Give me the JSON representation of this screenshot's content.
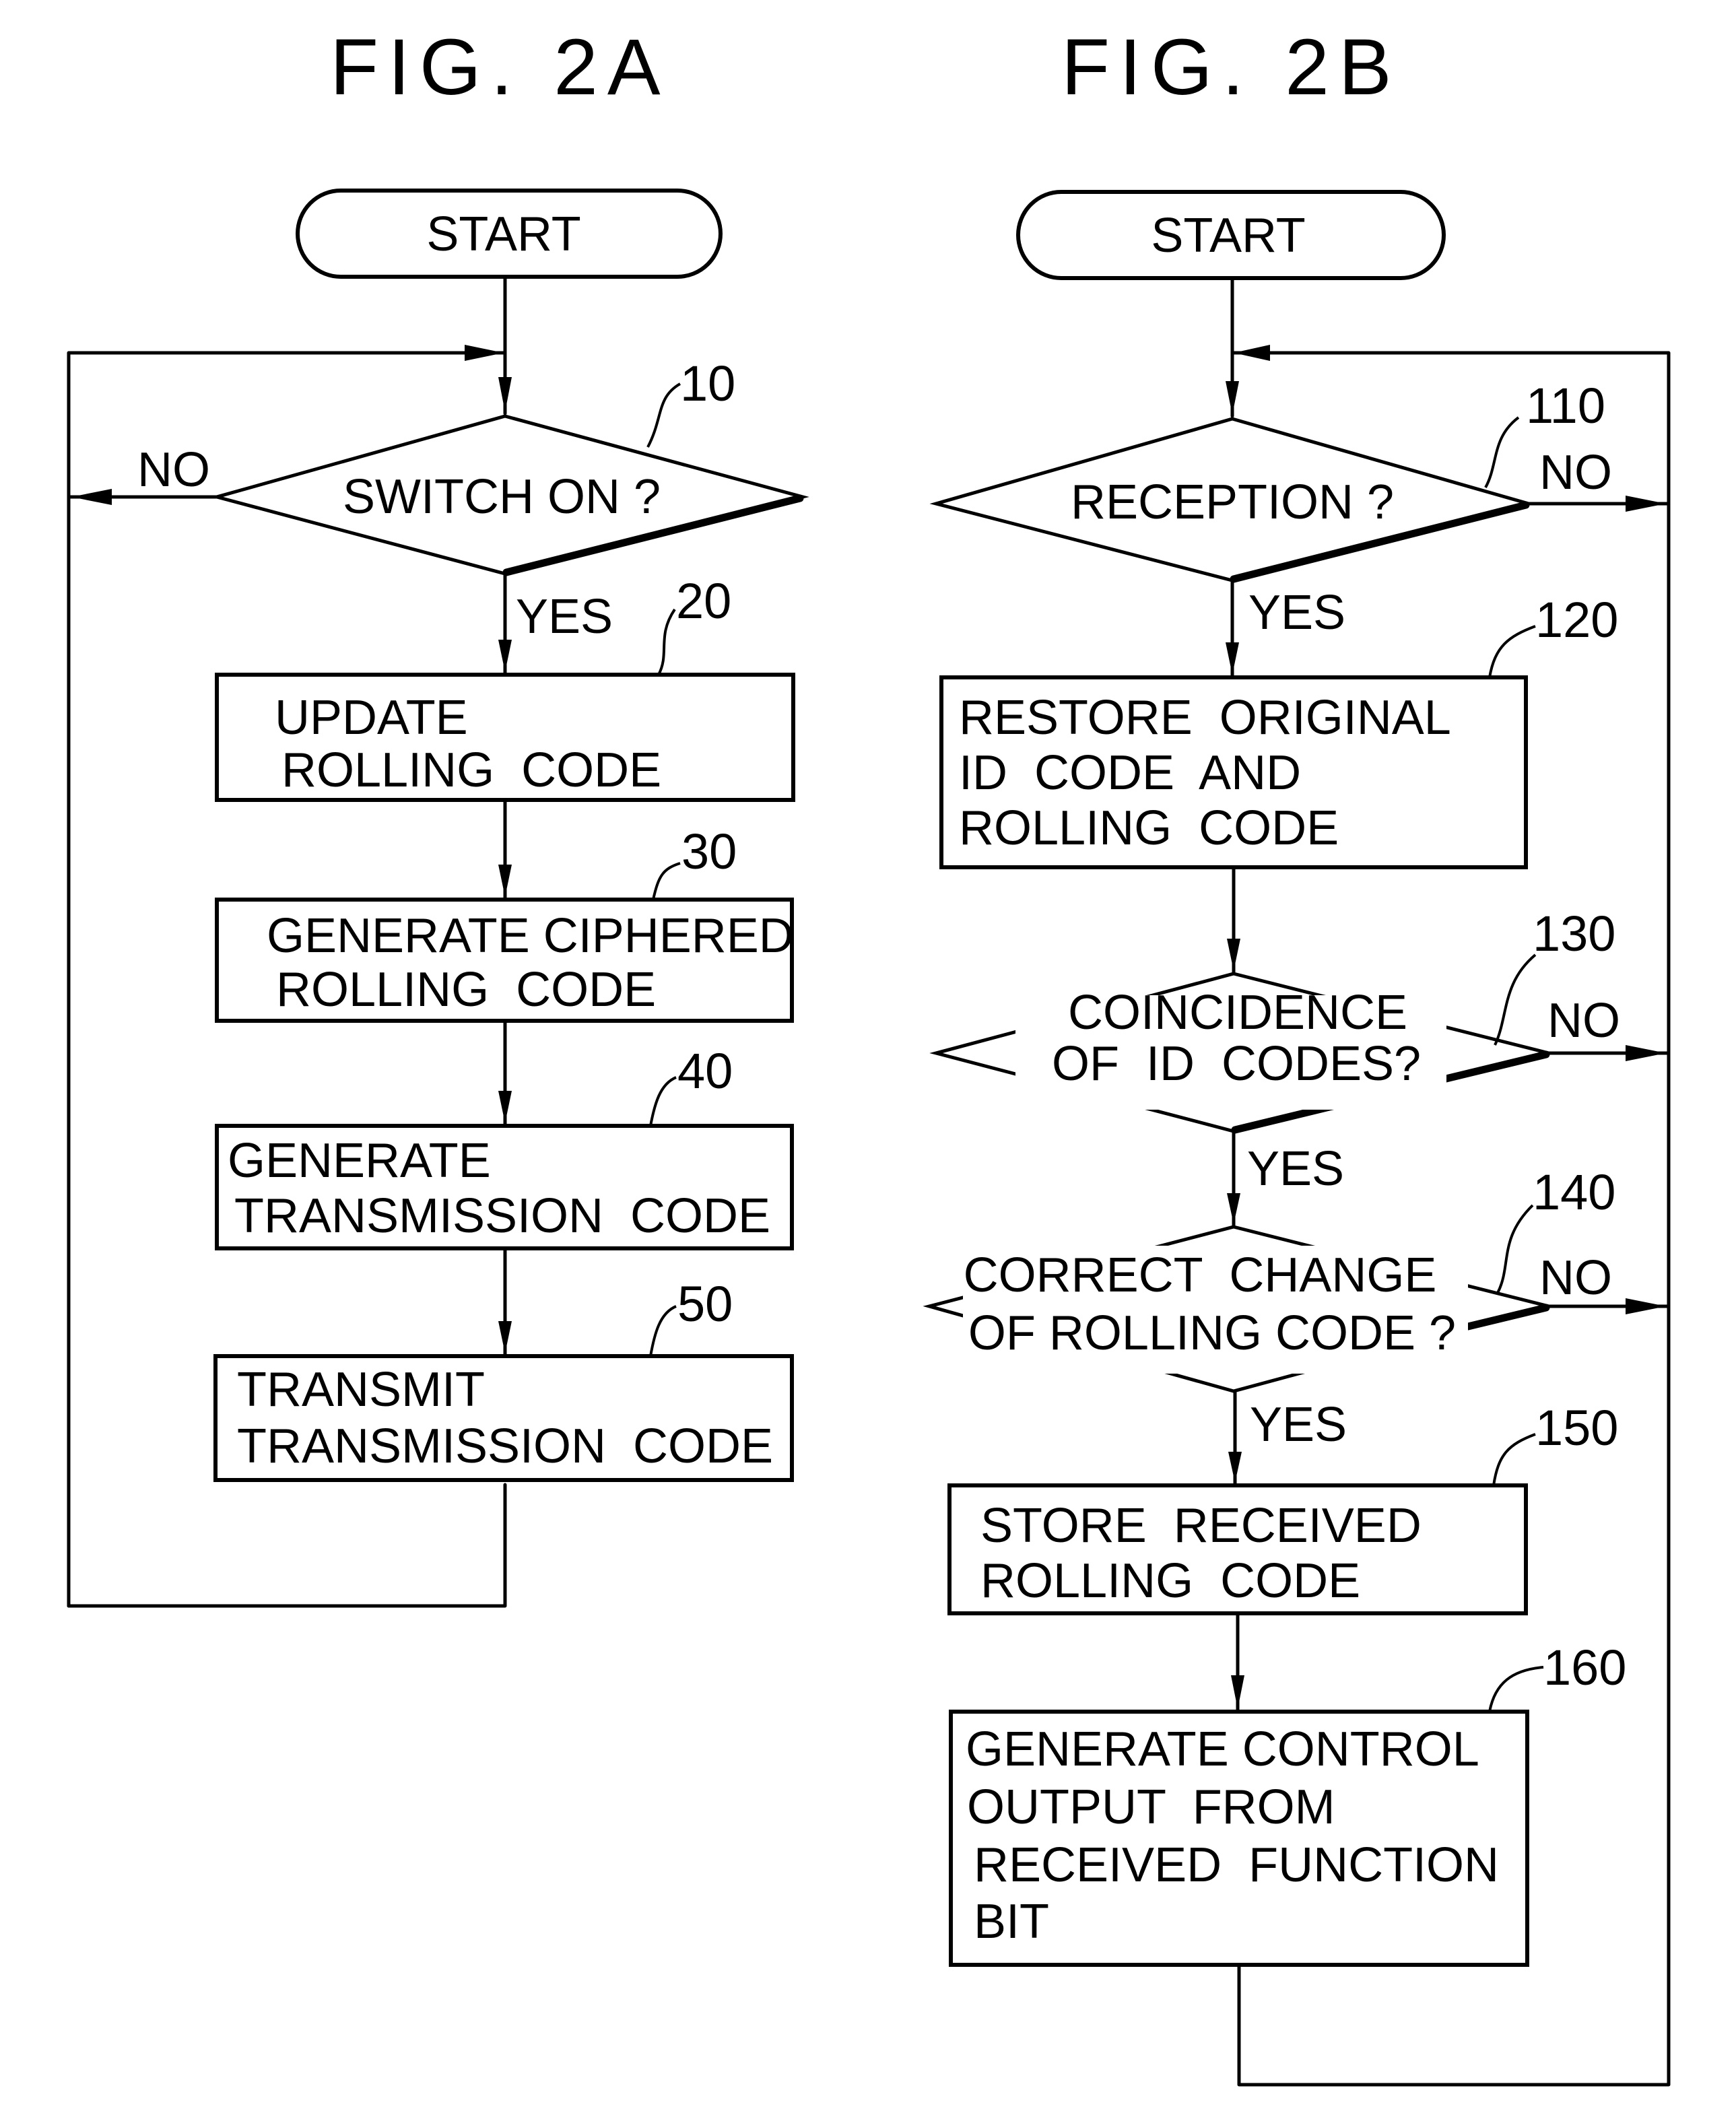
{
  "fig_a": {
    "title": "FIG. 2A",
    "start": "START",
    "steps": [
      {
        "ref": "10",
        "type": "decision",
        "lines": [
          "SWITCH ON ?"
        ],
        "yes": "YES",
        "no": "NO"
      },
      {
        "ref": "20",
        "type": "process",
        "lines": [
          "UPDATE",
          "ROLLING  CODE"
        ]
      },
      {
        "ref": "30",
        "type": "process",
        "lines": [
          "GENERATE CIPHERED",
          "ROLLING  CODE"
        ]
      },
      {
        "ref": "40",
        "type": "process",
        "lines": [
          "GENERATE",
          "TRANSMISSION  CODE"
        ]
      },
      {
        "ref": "50",
        "type": "process",
        "lines": [
          "TRANSMIT",
          "TRANSMISSION  CODE"
        ]
      }
    ]
  },
  "fig_b": {
    "title": "FIG. 2B",
    "start": "START",
    "steps": [
      {
        "ref": "110",
        "type": "decision",
        "lines": [
          "RECEPTION ?"
        ],
        "yes": "YES",
        "no": "NO"
      },
      {
        "ref": "120",
        "type": "process",
        "lines": [
          "RESTORE  ORIGINAL",
          "ID  CODE  AND",
          "ROLLING  CODE"
        ]
      },
      {
        "ref": "130",
        "type": "decision",
        "lines": [
          "COINCIDENCE",
          "OF  ID  CODES?"
        ],
        "yes": "YES",
        "no": "NO"
      },
      {
        "ref": "140",
        "type": "decision",
        "lines": [
          "CORRECT  CHANGE",
          "OF ROLLING CODE ?"
        ],
        "yes": "YES",
        "no": "NO"
      },
      {
        "ref": "150",
        "type": "process",
        "lines": [
          "STORE  RECEIVED",
          "ROLLING  CODE"
        ]
      },
      {
        "ref": "160",
        "type": "process",
        "lines": [
          "GENERATE CONTROL",
          "OUTPUT  FROM",
          "RECEIVED  FUNCTION",
          "BIT"
        ]
      }
    ]
  }
}
